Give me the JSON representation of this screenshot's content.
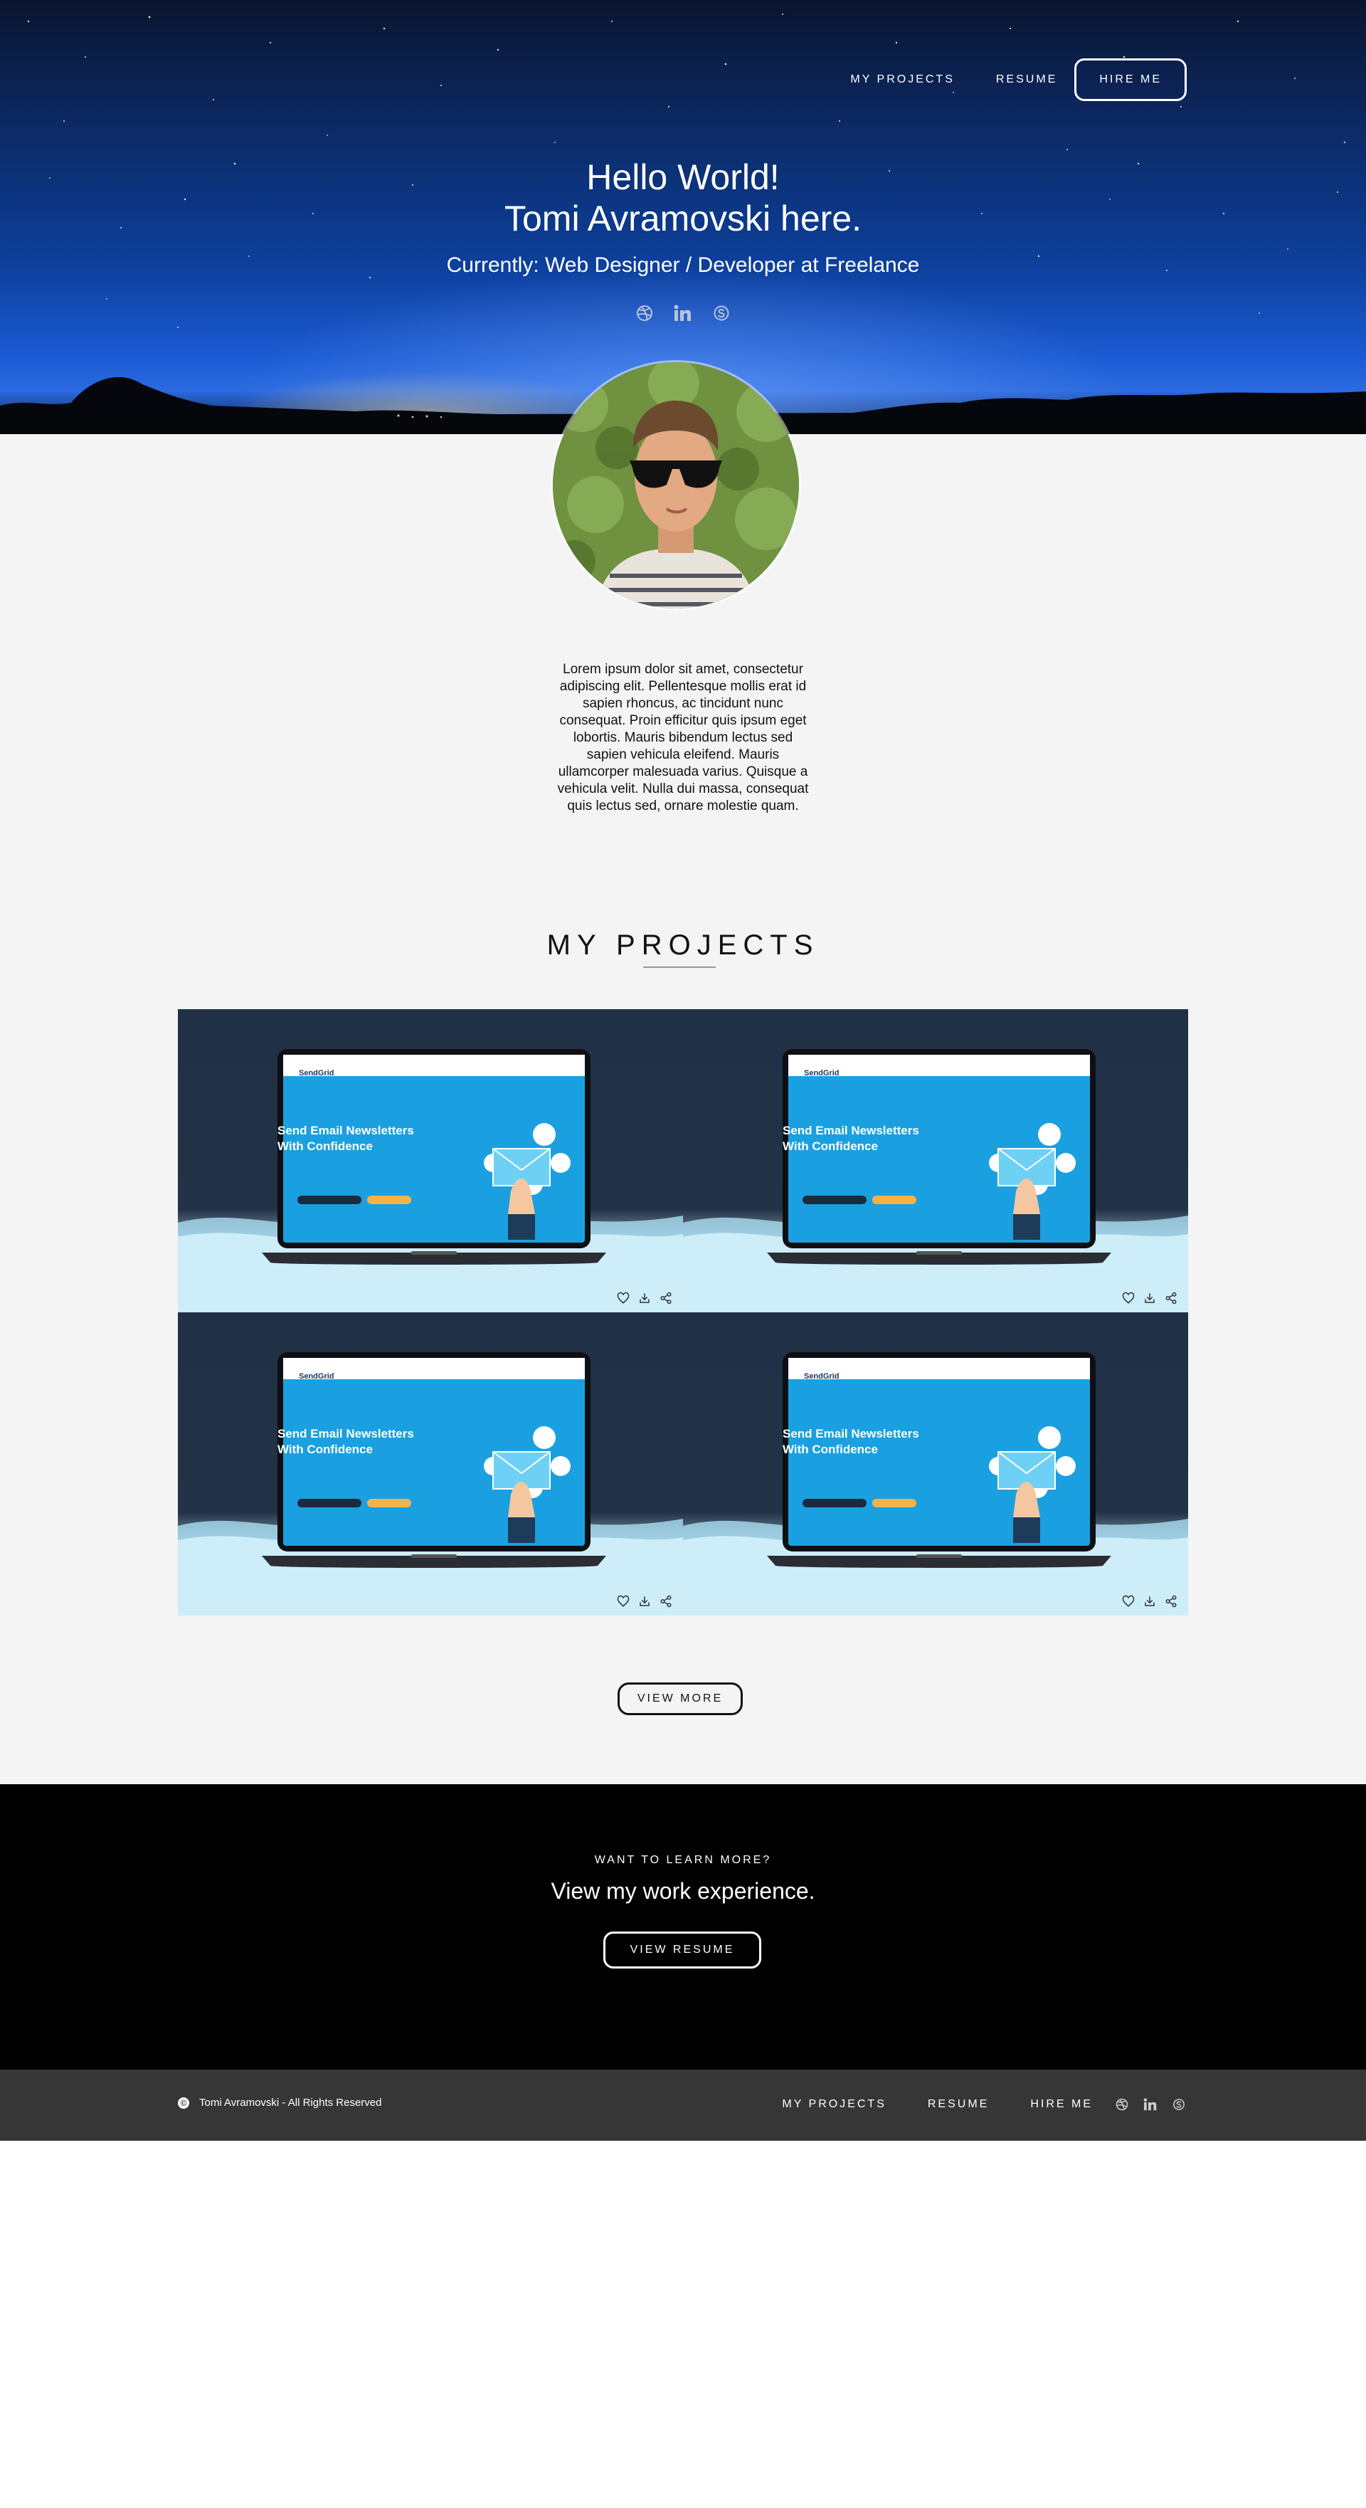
{
  "nav": {
    "projects": "MY PROJECTS",
    "resume": "RESUME",
    "hire": "HIRE ME"
  },
  "hero": {
    "line1": "Hello World!",
    "line2": "Tomi Avramovski here.",
    "line3": "Currently: Web Designer / Developer at Freelance",
    "social_icons": [
      "dribbble-icon",
      "linkedin-icon",
      "skype-icon"
    ]
  },
  "about": {
    "bio": "Lorem ipsum dolor sit amet, consectetur adipiscing elit. Pellentesque mollis erat id sapien rhoncus, ac tincidunt nunc consequat. Proin efficitur quis ipsum eget lobortis. Mauris bibendum lectus sed sapien vehicula eleifend. Mauris ullamcorper malesuada varius. Quisque a vehicula velit. Nulla dui massa, consequat quis lectus sed, ornare molestie quam."
  },
  "projects": {
    "title": "MY PROJECTS",
    "cards": [
      {
        "brand": "SendGrid",
        "heading1": "Send Email Newsletters",
        "heading2": "With Confidence"
      },
      {
        "brand": "SendGrid",
        "heading1": "Send Email Newsletters",
        "heading2": "With Confidence"
      },
      {
        "brand": "SendGrid",
        "heading1": "Send Email Newsletters",
        "heading2": "With Confidence"
      },
      {
        "brand": "SendGrid",
        "heading1": "Send Email Newsletters",
        "heading2": "With Confidence"
      }
    ],
    "card_actions": [
      "heart-icon",
      "download-icon",
      "share-icon"
    ],
    "view_more": "VIEW MORE"
  },
  "cta": {
    "kicker": "WANT TO LEARN MORE?",
    "headline": "View my work experience.",
    "button": "VIEW RESUME"
  },
  "footer": {
    "copyright": "Tomi Avramovski - All Rights Reserved",
    "projects": "MY PROJECTS",
    "resume": "RESUME",
    "hire": "HIRE ME"
  },
  "colors": {
    "hero_blue": "#0d3f9a",
    "page_bg": "#f4f4f4",
    "cta_bg": "#000000",
    "footer_bg": "#363636",
    "sendgrid_blue": "#1aa0e0"
  }
}
